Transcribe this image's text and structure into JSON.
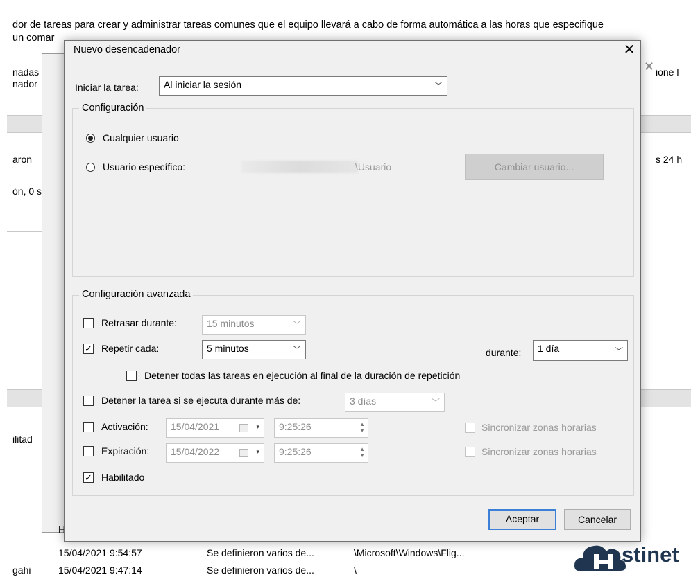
{
  "background": {
    "description_line1": "dor de tareas para crear y administrar tareas comunes que el equipo llevará a cabo de forma automática a las horas que especifique",
    "description_line2": "un comar",
    "left_fragments": [
      "nadas",
      "nador",
      "aron",
      "ón, 0 s",
      "ilitad"
    ],
    "right_fragments": [
      "ione l",
      "s 24 h"
    ],
    "rows": [
      {
        "col1": "H",
        "col2": "",
        "col3": ""
      },
      {
        "col1": "15/04/2021 9:54:57",
        "col2": "Se definieron varios de...",
        "col3": "\\Microsoft\\Windows\\Flig..."
      },
      {
        "col1": "15/04/2021 9:47:14",
        "col2": "Se definieron varios de...",
        "col3": "\\"
      }
    ],
    "row3_prefix": "gahi"
  },
  "dialog": {
    "title": "Nuevo desencadenador",
    "close_glyph": "✕",
    "start_label": "Iniciar la tarea:",
    "start_value": "Al iniciar la sesión",
    "config": {
      "title": "Configuración",
      "any_user": "Cualquier usuario",
      "specific_user": "Usuario específico:",
      "user_value": "\\Usuario",
      "change_user": "Cambiar usuario..."
    },
    "advanced": {
      "title": "Configuración avanzada",
      "delay_label": "Retrasar durante:",
      "delay_value": "15 minutos",
      "repeat_label": "Repetir cada:",
      "repeat_value": "5 minutos",
      "duration_label": "durante:",
      "duration_value": "1 día",
      "stop_all_label": "Detener todas las tareas en ejecución al final de la duración de repetición",
      "stop_if_label": "Detener la tarea si se ejecuta durante más de:",
      "stop_if_value": "3 días",
      "activation_label": "Activación:",
      "activation_date": "15/04/2021",
      "activation_time": "9:25:26",
      "expiration_label": "Expiración:",
      "expiration_date": "15/04/2022",
      "expiration_time": "9:25:26",
      "sync_label": "Sincronizar zonas horarias",
      "enabled_label": "Habilitado",
      "checkmark": "✓"
    },
    "ok": "Aceptar",
    "cancel": "Cancelar"
  },
  "watermark": "Hostinet",
  "colors": {
    "accent": "#3c7fd6",
    "logo": "#1f3550"
  }
}
